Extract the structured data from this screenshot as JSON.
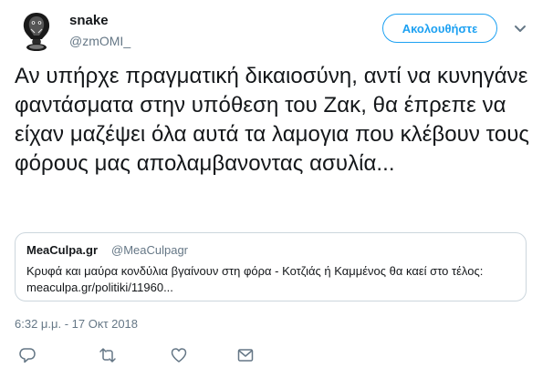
{
  "author": {
    "display_name": "snake",
    "screen_name": "@zmOMI_",
    "avatar_icon": "cobra-snake-avatar"
  },
  "follow_button": {
    "label": "Ακολουθήστε"
  },
  "tweet": {
    "text": "Αν υπήρχε πραγματική δικαιοσύνη, αντί να κυνηγάνε φαντάσματα στην υπόθεση του Ζακ,  θα έπρεπε να είχαν μαζέψει όλα αυτά τα λαμογια που κλέβουν τους φόρους μας απολαμβανοντας ασυλία...",
    "timestamp": "6:32 μ.μ. - 17 Οκτ 2018"
  },
  "quote": {
    "name": "MeaCulpa.gr",
    "handle": "@MeaCulpagr",
    "text": "Κρυφά και μαύρα κονδύλια βγαίνουν στη φόρα - Κοτζιάς ή Καμμένος θα καεί στο τέλος: meaculpa.gr/politiki/11960..."
  },
  "actions": {
    "reply_icon": "reply-icon",
    "retweet_icon": "retweet-icon",
    "like_icon": "heart-icon",
    "dm_icon": "direct-message-icon"
  },
  "colors": {
    "accent": "#1da1f2",
    "text": "#14171a",
    "secondary": "#657786",
    "border": "#ccd6dd"
  }
}
